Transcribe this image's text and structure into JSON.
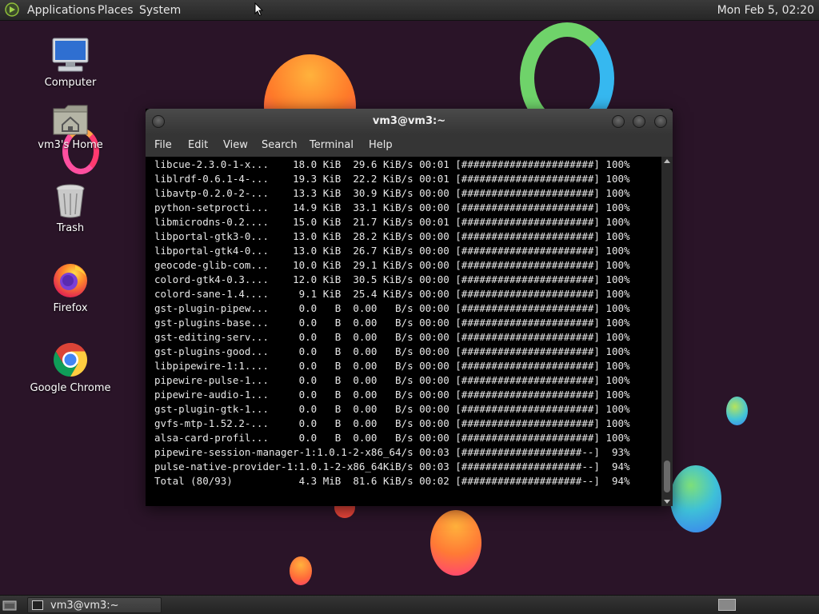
{
  "top_panel": {
    "menus": [
      "Applications",
      "Places",
      "System"
    ],
    "clock": "Mon Feb  5, 02:20"
  },
  "desktop_icons": [
    {
      "label": "Computer",
      "icon": "computer-icon"
    },
    {
      "label": "vm3's Home",
      "icon": "home-folder-icon"
    },
    {
      "label": "Trash",
      "icon": "trash-icon"
    },
    {
      "label": "Firefox",
      "icon": "firefox-icon"
    },
    {
      "label": "Google Chrome",
      "icon": "chrome-icon"
    }
  ],
  "terminal": {
    "title": "vm3@vm3:~",
    "menu": [
      "File",
      "Edit",
      "View",
      "Search",
      "Terminal",
      "Help"
    ],
    "lines": [
      "libcue-2.3.0-1-x...    18.0 KiB  29.6 KiB/s 00:01 [######################] 100%",
      "liblrdf-0.6.1-4-...    19.3 KiB  22.2 KiB/s 00:01 [######################] 100%",
      "libavtp-0.2.0-2-...    13.3 KiB  30.9 KiB/s 00:00 [######################] 100%",
      "python-setprocti...    14.9 KiB  33.1 KiB/s 00:00 [######################] 100%",
      "libmicrodns-0.2....    15.0 KiB  21.7 KiB/s 00:01 [######################] 100%",
      "libportal-gtk3-0...    13.0 KiB  28.2 KiB/s 00:00 [######################] 100%",
      "libportal-gtk4-0...    13.0 KiB  26.7 KiB/s 00:00 [######################] 100%",
      "geocode-glib-com...    10.0 KiB  29.1 KiB/s 00:00 [######################] 100%",
      "colord-gtk4-0.3....    12.0 KiB  30.5 KiB/s 00:00 [######################] 100%",
      "colord-sane-1.4....     9.1 KiB  25.4 KiB/s 00:00 [######################] 100%",
      "gst-plugin-pipew...     0.0   B  0.00   B/s 00:00 [######################] 100%",
      "gst-plugins-base...     0.0   B  0.00   B/s 00:00 [######################] 100%",
      "gst-editing-serv...     0.0   B  0.00   B/s 00:00 [######################] 100%",
      "gst-plugins-good...     0.0   B  0.00   B/s 00:00 [######################] 100%",
      "libpipewire-1:1....     0.0   B  0.00   B/s 00:00 [######################] 100%",
      "pipewire-pulse-1...     0.0   B  0.00   B/s 00:00 [######################] 100%",
      "pipewire-audio-1...     0.0   B  0.00   B/s 00:00 [######################] 100%",
      "gst-plugin-gtk-1...     0.0   B  0.00   B/s 00:00 [######################] 100%",
      "gvfs-mtp-1.52.2-...     0.0   B  0.00   B/s 00:00 [######################] 100%",
      "alsa-card-profil...     0.0   B  0.00   B/s 00:00 [######################] 100%",
      "pipewire-session-manager-1:1.0.1-2-x86_64/s 00:03 [####################--]  93%",
      "pulse-native-provider-1:1.0.1-2-x86_64KiB/s 00:03 [####################--]  94%",
      "Total (80/93)           4.3 MiB  81.6 KiB/s 00:02 [####################--]  94%"
    ]
  },
  "taskbar": {
    "task_label": "vm3@vm3:~"
  }
}
